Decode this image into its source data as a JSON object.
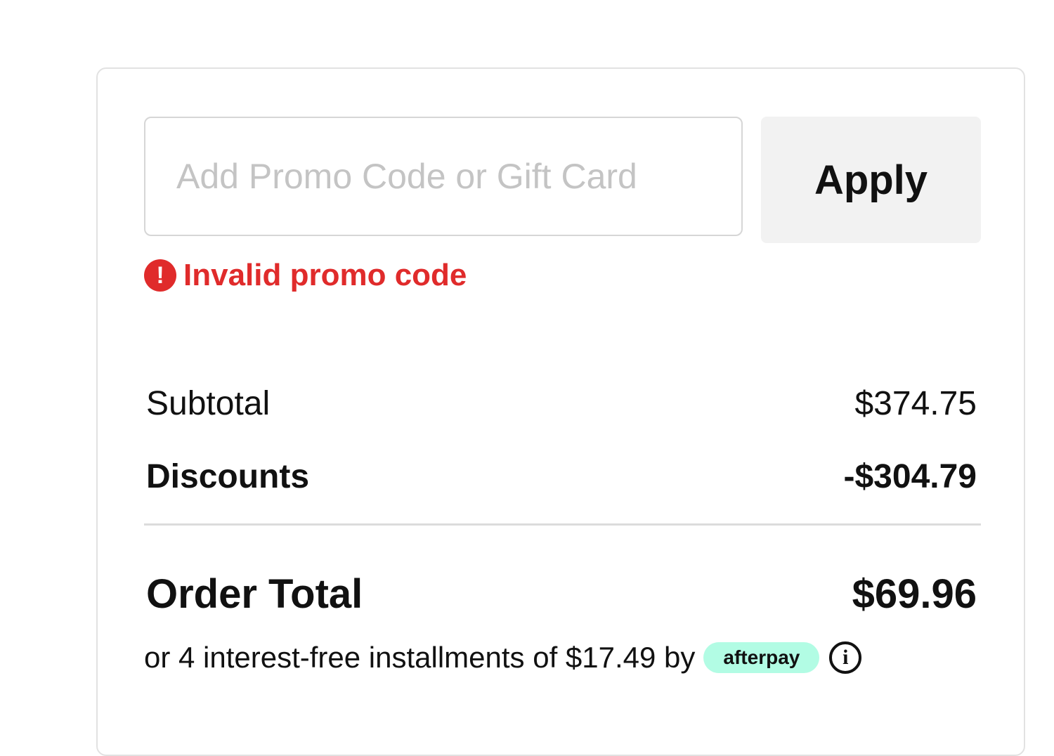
{
  "promo": {
    "placeholder": "Add Promo Code or Gift Card",
    "value": "",
    "apply_label": "Apply",
    "error_icon": "!",
    "error_text": "Invalid promo code"
  },
  "summary": {
    "subtotal_label": "Subtotal",
    "subtotal_value": "$374.75",
    "discounts_label": "Discounts",
    "discounts_value": "-$304.79",
    "total_label": "Order Total",
    "total_value": "$69.96"
  },
  "installments": {
    "text": "or 4 interest-free installments of $17.49 by",
    "badge_label": "afterpay",
    "info_icon": "i"
  },
  "colors": {
    "error": "#e02b2b",
    "afterpay_badge": "#b2fce4",
    "apply_background": "#f2f2f2"
  }
}
